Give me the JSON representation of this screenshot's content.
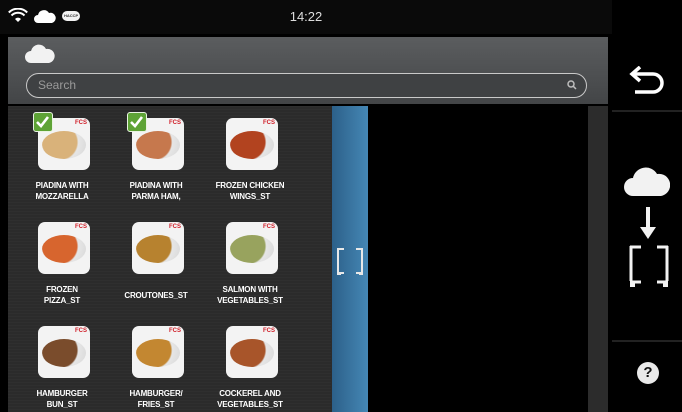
{
  "status": {
    "time": "14:22",
    "haccp_label": "HACCP"
  },
  "search": {
    "placeholder": "Search"
  },
  "fcs_label": "FCS",
  "recipes": [
    {
      "label": "PIADINA WITH MOZZARELLA",
      "line1": "PIADINA WITH",
      "line2": "MOZZARELLA",
      "selected": true,
      "dish_color": "#d9b27a"
    },
    {
      "label": "PIADINA WITH PARMA HAM,",
      "line1": "PIADINA WITH",
      "line2": "PARMA HAM,",
      "selected": true,
      "dish_color": "#c6784d"
    },
    {
      "label": "FROZEN CHICKEN WINGS_ST",
      "line1": "FROZEN CHICKEN",
      "line2": "WINGS_ST",
      "selected": false,
      "dish_color": "#b2431f"
    },
    {
      "label": "FROZEN PIZZA_ST",
      "line1": "FROZEN",
      "line2": "PIZZA_ST",
      "selected": false,
      "dish_color": "#d7652e"
    },
    {
      "label": "CROUTONES_ST",
      "line1": "CROUTONES_ST",
      "line2": "",
      "selected": false,
      "dish_color": "#b7822f"
    },
    {
      "label": "SALMON WITH VEGETABLES_ST",
      "line1": "SALMON WITH",
      "line2": "VEGETABLES_ST",
      "selected": false,
      "dish_color": "#98a35e"
    },
    {
      "label": "HAMBURGER BUN_ST",
      "line1": "HAMBURGER",
      "line2": "BUN_ST",
      "selected": false,
      "dish_color": "#7a4c2c"
    },
    {
      "label": "HAMBURGER/ FRIES_ST",
      "line1": "HAMBURGER/",
      "line2": "FRIES_ST",
      "selected": false,
      "dish_color": "#c38731"
    },
    {
      "label": "COCKEREL AND VEGETABLES_ST",
      "line1": "COCKEREL AND",
      "line2": "VEGETABLES_ST",
      "selected": false,
      "dish_color": "#a8552a"
    }
  ],
  "rail": {
    "help_label": "?"
  },
  "colors": {
    "accent_blue": "#3a78a8",
    "check_green": "#5ea336",
    "fcs_red": "#d0202a"
  }
}
